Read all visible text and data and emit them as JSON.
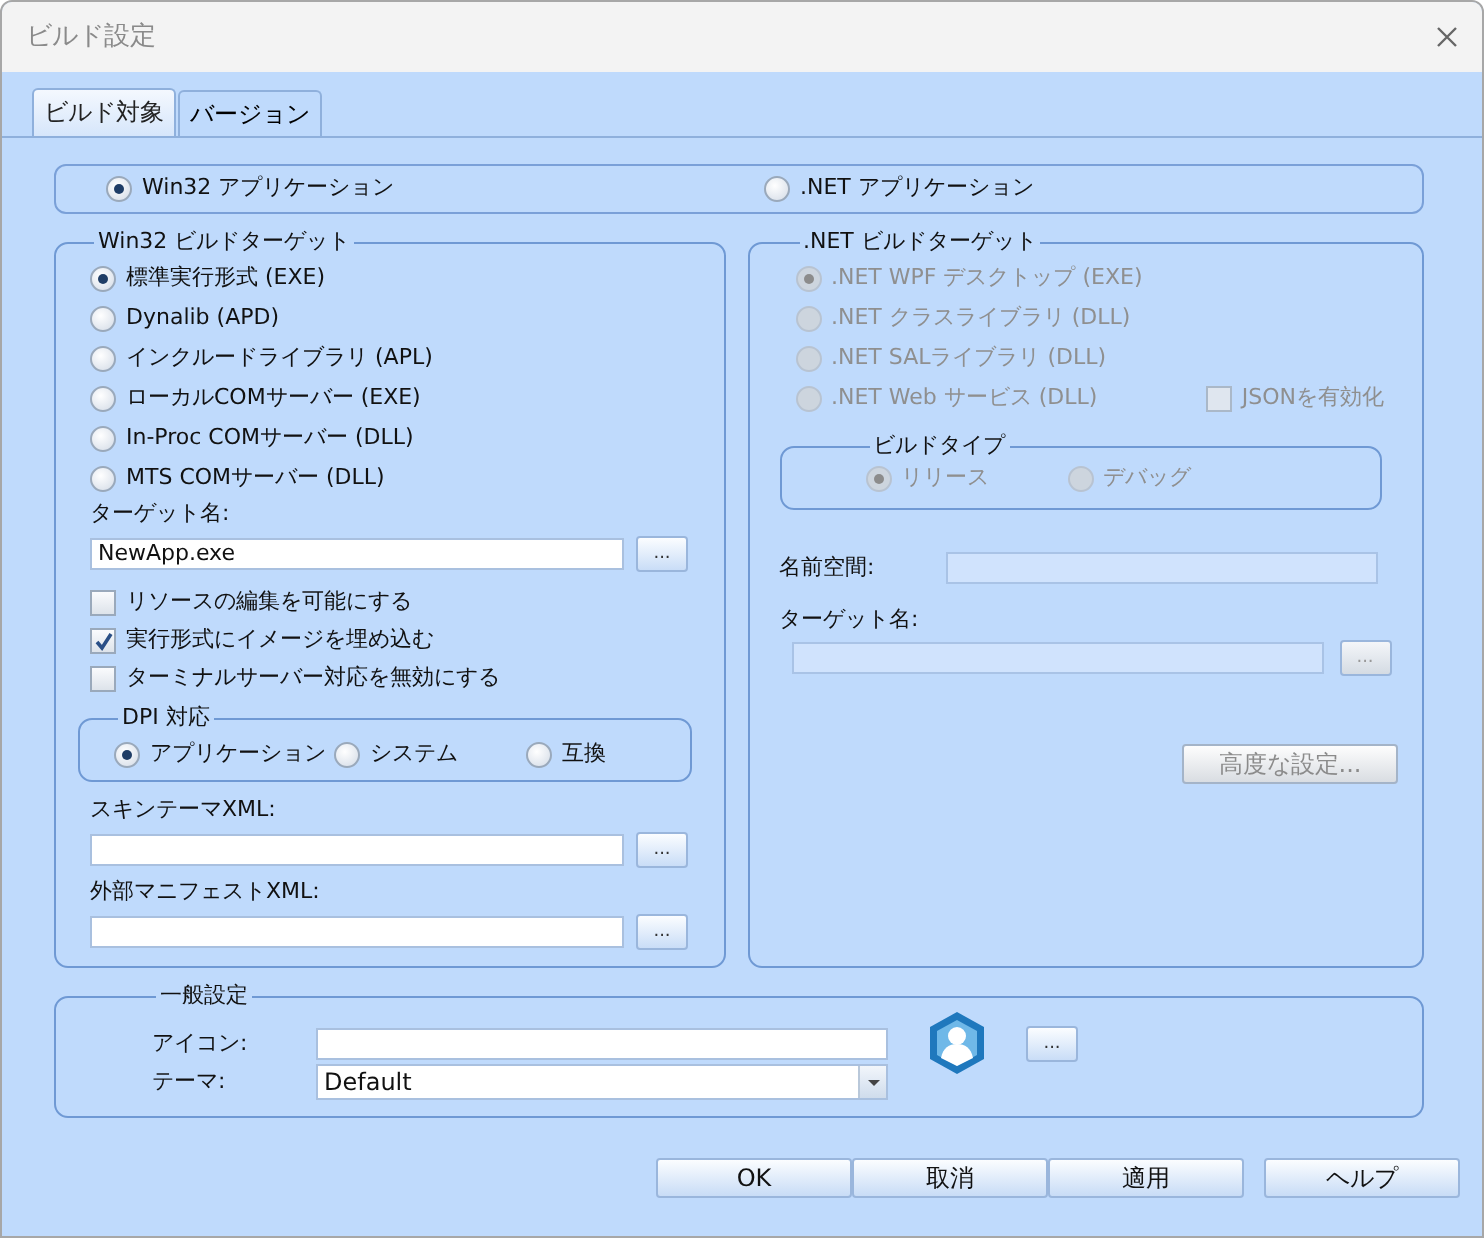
{
  "window": {
    "title": "ビルド設定"
  },
  "tabs": [
    {
      "label": "ビルド対象",
      "selected": true
    },
    {
      "label": "バージョン",
      "selected": false
    }
  ],
  "app_type": [
    {
      "label": "Win32 アプリケーション",
      "selected": true
    },
    {
      "label": ".NET アプリケーション",
      "selected": false
    }
  ],
  "win32": {
    "legend": "Win32 ビルドターゲット",
    "targets": [
      {
        "label": "標準実行形式 (EXE)",
        "selected": true
      },
      {
        "label": "Dynalib (APD)",
        "selected": false
      },
      {
        "label": "インクルードライブラリ (APL)",
        "selected": false
      },
      {
        "label": "ローカルCOMサーバー (EXE)",
        "selected": false
      },
      {
        "label": "In-Proc COMサーバー (DLL)",
        "selected": false
      },
      {
        "label": "MTS COMサーバー (DLL)",
        "selected": false
      }
    ],
    "target_name": {
      "label": "ターゲット名:",
      "value": "NewApp.exe",
      "browse": "..."
    },
    "options": [
      {
        "label": "リソースの編集を可能にする",
        "checked": false
      },
      {
        "label": "実行形式にイメージを埋め込む",
        "checked": true
      },
      {
        "label": "ターミナルサーバー対応を無効にする",
        "checked": false
      }
    ],
    "dpi": {
      "legend": "DPI 対応",
      "options": [
        {
          "label": "アプリケーション",
          "selected": true
        },
        {
          "label": "システム",
          "selected": false
        },
        {
          "label": "互換",
          "selected": false
        }
      ]
    },
    "skin_xml": {
      "label": "スキンテーマXML:",
      "browse": "..."
    },
    "manifest_xml": {
      "label": "外部マニフェストXML:",
      "browse": "..."
    }
  },
  "dotnet": {
    "legend": ".NET ビルドターゲット",
    "disabled": true,
    "targets": [
      {
        "label": ".NET WPF デスクトップ (EXE)",
        "selected": true
      },
      {
        "label": ".NET クラスライブラリ (DLL)",
        "selected": false
      },
      {
        "label": ".NET SALライブラリ (DLL)",
        "selected": false
      },
      {
        "label": ".NET Web サービス (DLL)",
        "selected": false
      }
    ],
    "json": {
      "label": "JSONを有効化",
      "checked": false
    },
    "build_type": {
      "legend": "ビルドタイプ",
      "options": [
        {
          "label": "リリース",
          "selected": true
        },
        {
          "label": "デバッグ",
          "selected": false
        }
      ]
    },
    "namespace": {
      "label": "名前空間:"
    },
    "target_name": {
      "label": "ターゲット名:",
      "browse": "..."
    },
    "advanced": "高度な設定..."
  },
  "general": {
    "legend": "一般設定",
    "icon": {
      "label": "アイコン:",
      "browse": "..."
    },
    "theme": {
      "label": "テーマ:",
      "value": "Default"
    }
  },
  "buttons": [
    "OK",
    "取消",
    "適用",
    "ヘルプ"
  ]
}
